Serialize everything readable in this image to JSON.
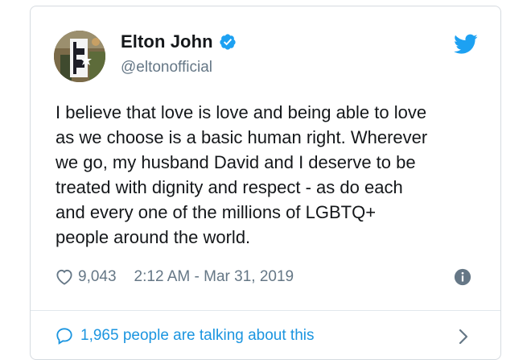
{
  "tweet": {
    "author": {
      "display_name": "Elton John",
      "handle": "@eltonofficial",
      "verified": true
    },
    "text": "I believe that love is love and being able to love\nas we choose is a basic human right. Wherever\nwe go, my husband David and I deserve to be\ntreated with dignity and respect - as do each\nand every one of the millions of LGBTQ+\npeople around the world.",
    "likes": "9,043",
    "timestamp": "2:12 AM - Mar 31, 2019",
    "talking_about": "1,965 people are talking about this"
  },
  "icons": {
    "brand": "twitter-bird-icon",
    "verified": "verified-badge-icon",
    "like": "heart-icon",
    "info": "info-icon",
    "comment": "comment-icon",
    "chevron": "chevron-right-icon"
  },
  "colors": {
    "twitter_blue": "#1da1f2",
    "link_blue": "#1b95e0",
    "text": "#14171a",
    "secondary": "#657786",
    "border": "#d6dbe0"
  }
}
